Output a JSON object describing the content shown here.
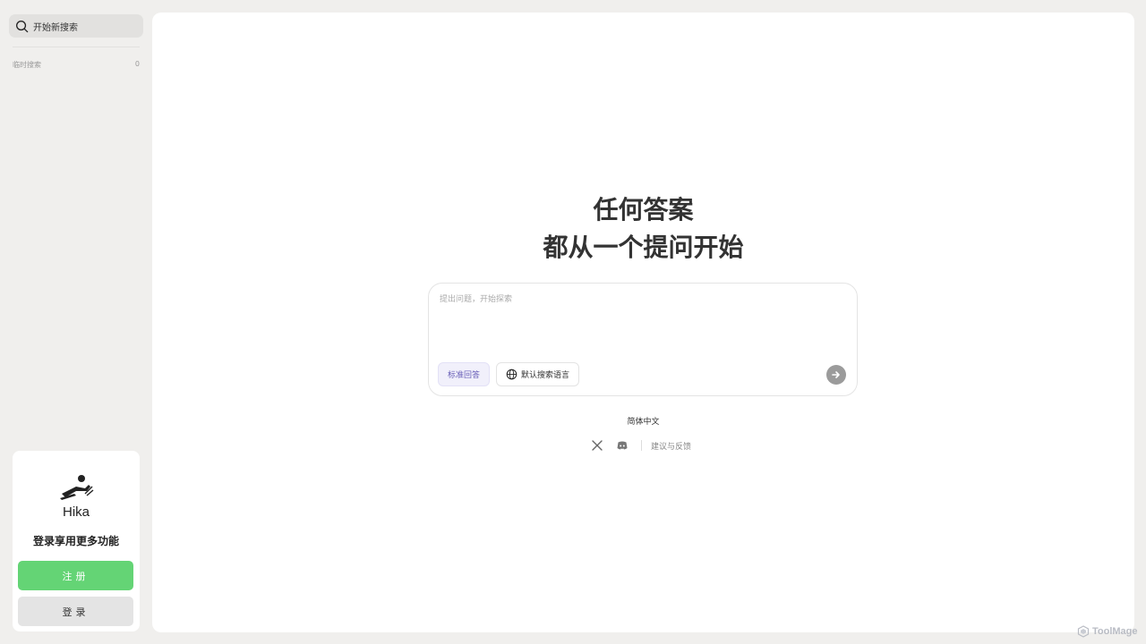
{
  "sidebar": {
    "search_label": "开始新搜索",
    "history_label": "临时搜索",
    "history_count": "0",
    "login_card": {
      "logo_text": "Hika",
      "tip": "登录享用更多功能",
      "register_label": "注册",
      "login_label": "登录"
    }
  },
  "main": {
    "headline_line1": "任何答案",
    "headline_line2": "都从一个提问开始",
    "input": {
      "placeholder": "提出问题，开始探索",
      "value": ""
    },
    "mode_label": "标准回答",
    "lang_label": "默认搜索语言",
    "ui_language": "简体中文",
    "feedback_label": "建议与反馈"
  },
  "watermark": "ToolMage",
  "colors": {
    "accent_green": "#64d475",
    "mode_chip_text": "#6a60b8",
    "background": "#f0efed"
  }
}
